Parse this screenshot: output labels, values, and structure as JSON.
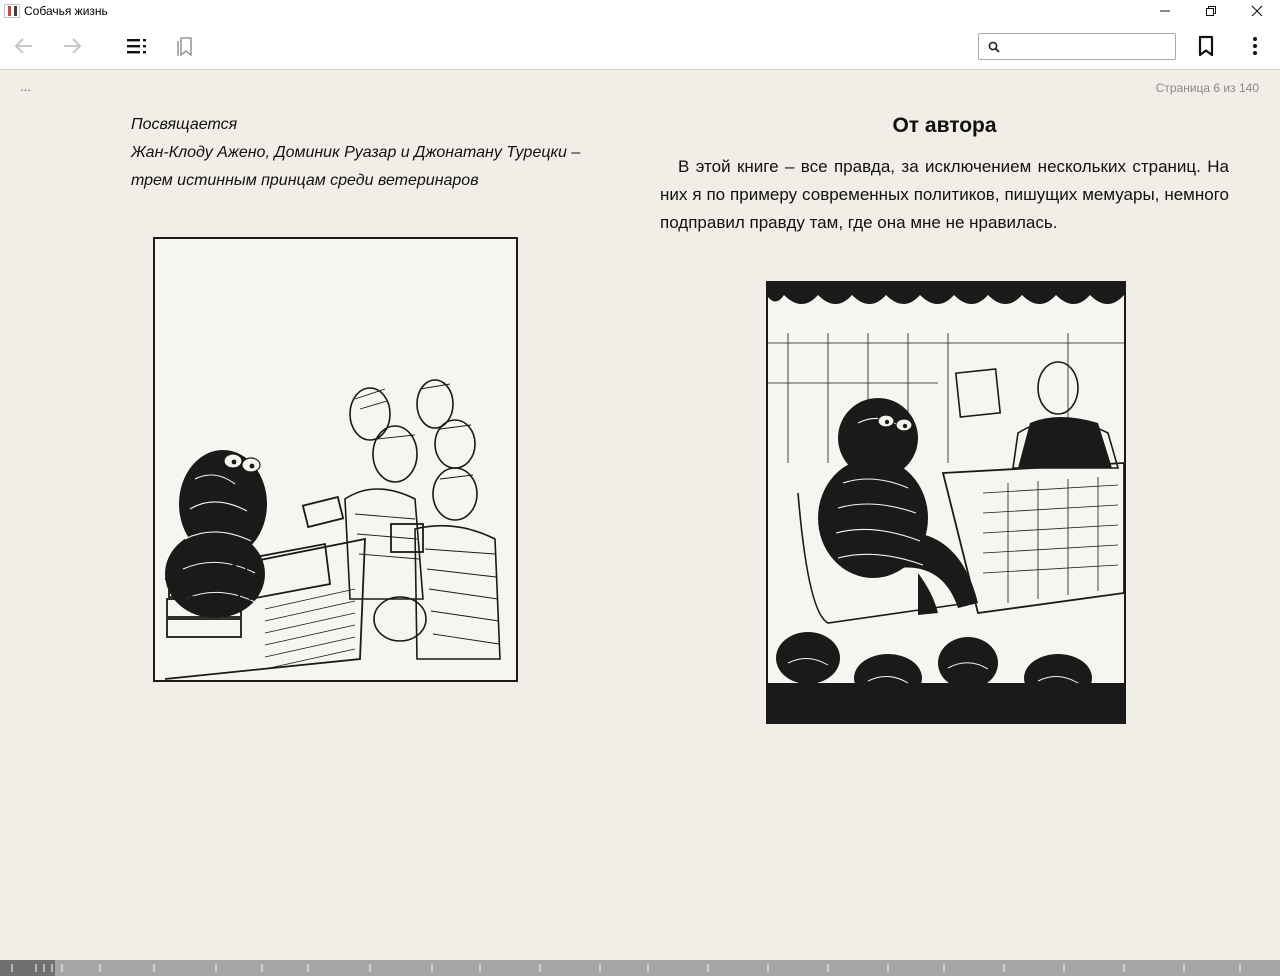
{
  "window": {
    "title": "Собачья жизнь"
  },
  "toolbar": {
    "back_icon": "arrow-left-icon",
    "forward_icon": "arrow-right-icon",
    "toc_icon": "table-of-contents-icon",
    "bookmarks_list_icon": "bookmarks-icon",
    "search_icon": "search-icon",
    "bookmark_icon": "bookmark-icon",
    "menu_icon": "more-vertical-icon",
    "search_value": ""
  },
  "reader": {
    "ellipsis": "...",
    "page_indicator": "Страница 6 из 140",
    "left_page": {
      "dedication_lines": [
        "Посвящается",
        "Жан-Клоду Ажено, Доминик Руазар и Джонатану Турецки –",
        "трем истинным принцам среди ветеринаров"
      ]
    },
    "right_page": {
      "heading": "От автора",
      "paragraph": "В этой книге – все правда, за исключением нескольких страниц. На них я по примеру современных политиков, пишущих мемуары, немного подправил правду там, где она мне не нравилась."
    }
  },
  "progress": {
    "current_page": 6,
    "total_pages": 140
  },
  "colors": {
    "paper": "#f1eee8",
    "ink": "#111111",
    "muted": "#888888",
    "progress_track": "#a6a6a6",
    "progress_fill": "#6f6f6f"
  }
}
